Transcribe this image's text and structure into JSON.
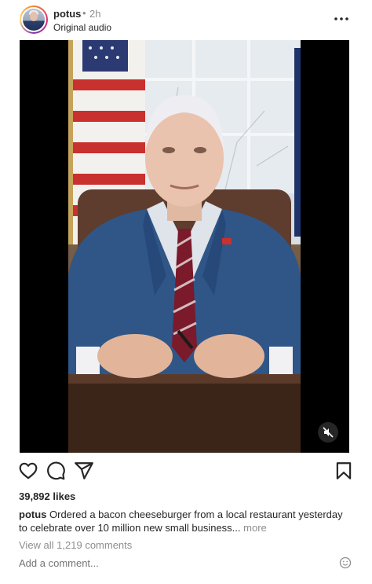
{
  "post": {
    "username": "potus",
    "separator": "•",
    "time": "2h",
    "audio_label": "Original audio"
  },
  "icons": {
    "more": "more-horizontal-icon",
    "mute": "volume-muted-icon",
    "like": "heart-icon",
    "comment": "comment-icon",
    "share": "send-icon",
    "save": "bookmark-icon",
    "emoji": "smiley-icon"
  },
  "stats": {
    "likes": "39,892 likes"
  },
  "caption": {
    "username": "potus",
    "text": "Ordered a bacon cheeseburger from a local restaurant yesterday to celebrate over 10 million new small business...",
    "more": "more"
  },
  "comments": {
    "view_all": "View all 1,219 comments",
    "add_placeholder": "Add a comment..."
  },
  "colors": {
    "text": "#262626",
    "secondary": "#8e8e8e",
    "video_bg": "#000000"
  }
}
